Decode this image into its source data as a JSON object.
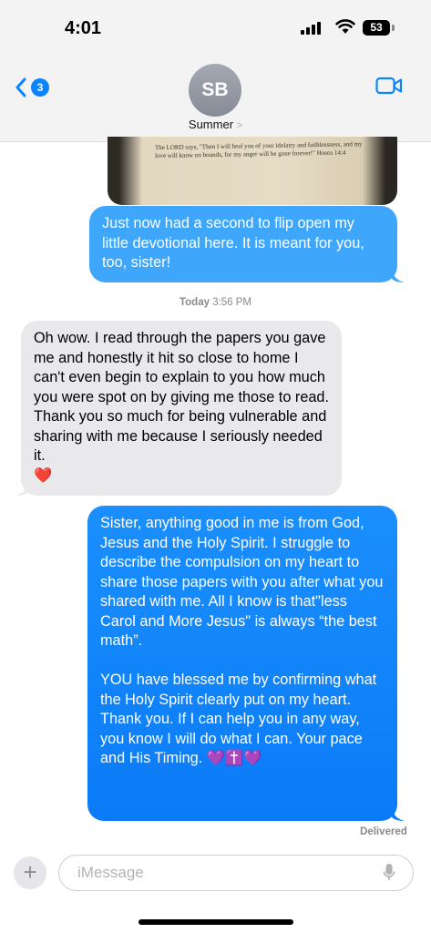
{
  "status_bar": {
    "time": "4:01",
    "battery": "53"
  },
  "header": {
    "back_badge": "3",
    "avatar_initials": "SB",
    "contact_name": "Summer",
    "contact_chevron": ">"
  },
  "thread": {
    "photo_caption": "The LORD says, \"Then I will heal you of your idolatry and faithlessness, and my love will know no bounds, for my anger will be gone forever!\" Hosea 14:4",
    "messages": [
      {
        "direction": "outgoing",
        "text": "Just now had a second to flip open my little devotional here.   It is meant for you, too, sister!"
      },
      {
        "direction": "incoming",
        "text": "Oh wow. I read through the papers you gave me and honestly it hit so close to home I can't even begin to explain to you how much you were spot on by giving me those to read. Thank you so much for being vulnerable and sharing with me because I seriously needed it.\n❤️"
      },
      {
        "direction": "outgoing",
        "text": "Sister, anything good in me is from God, Jesus and the Holy Spirit.  I struggle to  describe the compulsion on my heart to share those papers with you after what you shared with me.  All I know is that\"less Carol and More Jesus\" is always “the best math”.\n\nYOU have blessed me by confirming what the Holy Spirit clearly put on my heart.  Thank you.   If I can help you in any way, you know I will do what I can.  Your pace and His Timing. 💜✝️💜"
      }
    ],
    "timestamp_day": "Today",
    "timestamp_time": "3:56 PM",
    "delivered_label": "Delivered"
  },
  "composer": {
    "plus_label": "+",
    "placeholder": "iMessage"
  },
  "colors": {
    "outgoing": "#0b84ff",
    "incoming": "#e9e9eb",
    "accent": "#0b84ff"
  }
}
